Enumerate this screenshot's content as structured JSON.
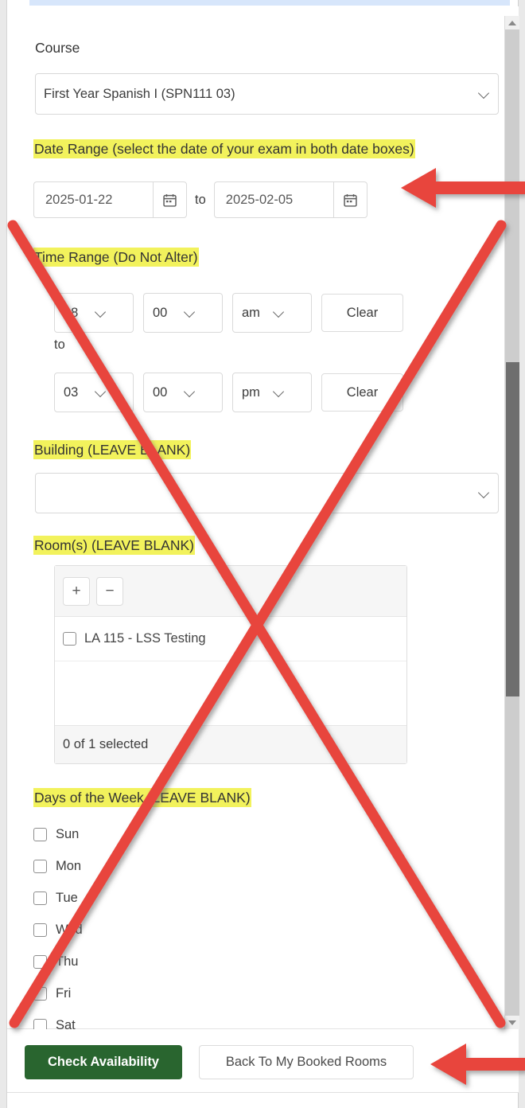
{
  "form": {
    "course": {
      "label": "Course",
      "value": "First Year Spanish I (SPN111 03)"
    },
    "date_range": {
      "label": "Date Range (select the date of your exam in both date boxes)",
      "start": "2025-01-22",
      "end": "2025-02-05",
      "separator": "to"
    },
    "time_range": {
      "label": "Time Range (Do Not Alter)",
      "separator": "to",
      "start": {
        "hour": "08",
        "minute": "00",
        "meridiem": "am",
        "clear_label": "Clear"
      },
      "end": {
        "hour": "03",
        "minute": "00",
        "meridiem": "pm",
        "clear_label": "Clear"
      }
    },
    "building": {
      "label": "Building (LEAVE BLANK)",
      "value": ""
    },
    "rooms": {
      "label": "Room(s) (LEAVE BLANK)",
      "add_label": "+",
      "remove_label": "−",
      "items": [
        {
          "name": "LA 115 - LSS Testing",
          "checked": false
        }
      ],
      "status": "0 of 1 selected"
    },
    "days": {
      "label": "Days of the Week (LEAVE BLANK)",
      "items": [
        {
          "name": "Sun",
          "checked": false
        },
        {
          "name": "Mon",
          "checked": false
        },
        {
          "name": "Tue",
          "checked": false
        },
        {
          "name": "Wed",
          "checked": false
        },
        {
          "name": "Thu",
          "checked": false
        },
        {
          "name": "Fri",
          "checked": false
        },
        {
          "name": "Sat",
          "checked": false
        }
      ]
    }
  },
  "footer": {
    "primary_label": "Check Availability",
    "secondary_label": "Back To My Booked Rooms"
  },
  "colors": {
    "highlight": "#f2f25c",
    "primary_button": "#29652f",
    "annotation_red": "#e8453c",
    "scrollbar_thumb": "#6e6e6e",
    "scrollbar_track": "#cdcdcd",
    "top_bar_blue": "#d7e6fb"
  }
}
